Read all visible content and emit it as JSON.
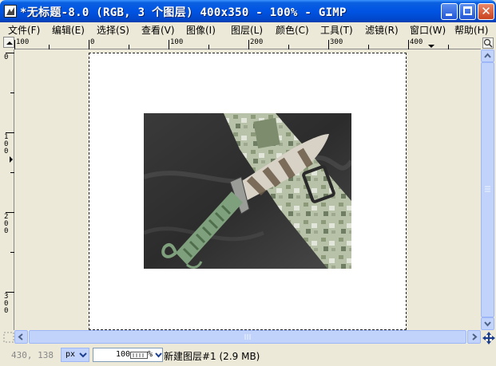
{
  "window": {
    "title": "*无标题-8.0 (RGB, 3 个图层) 400x350 - 100% - GIMP"
  },
  "menu": {
    "items": [
      {
        "label": "文件(F)"
      },
      {
        "label": "编辑(E)"
      },
      {
        "label": "选择(S)"
      },
      {
        "label": "查看(V)"
      },
      {
        "label": "图像(I)"
      },
      {
        "label": "图层(L)"
      },
      {
        "label": "颜色(C)"
      },
      {
        "label": "工具(T)"
      },
      {
        "label": "滤镜(R)"
      },
      {
        "label": "窗口(W)"
      },
      {
        "label": "帮助(H)"
      }
    ]
  },
  "rulers": {
    "horizontal": [
      "100",
      "0",
      "100",
      "200",
      "300",
      "400"
    ],
    "vertical": [
      "0",
      "100",
      "200",
      "300"
    ]
  },
  "statusbar": {
    "coords": "430, 138",
    "unit": "px",
    "zoom": "100",
    "zoom_unit": "%",
    "layer_info": "新建图层#1 (2.9 MB)"
  },
  "colors": {
    "titlebar": "#0054e3",
    "scroll": "#c1d3fb",
    "workspace": "#ece9d8"
  }
}
